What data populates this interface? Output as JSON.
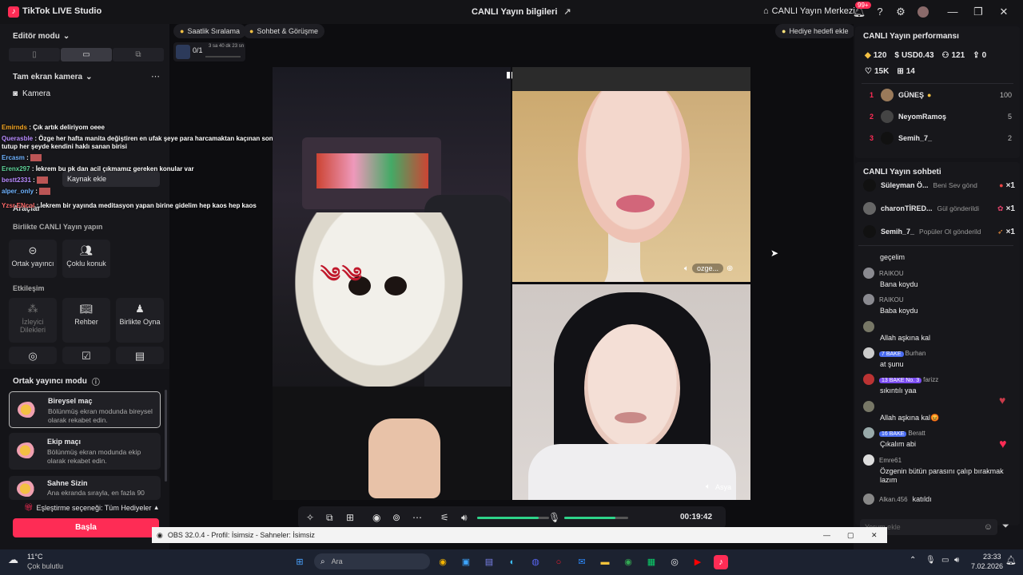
{
  "titlebar": {
    "app_title": "TikTok LIVE Studio",
    "center_title": "CANLI Yayın bilgileri",
    "live_center": "CANLI Yayın Merkezi",
    "notif_count": "99+"
  },
  "left": {
    "editor_mode": "Editör modu",
    "camera_section": "Tam ekran kamera",
    "camera_item": "Kamera",
    "add_source": "Kaynak ekle",
    "tools_label": "Araçlar",
    "cohost_section": "Birlikte CANLI Yayın yapın",
    "cohost_btn": "Ortak yayıncı",
    "multi_guest_btn": "Çoklu konuk",
    "interaction_section": "Etkileşim",
    "viewer_requests": "İzleyici Dilekleri",
    "guide": "Rehber",
    "play_together": "Birlikte Oyna",
    "cohost_mode_title": "Ortak yayıncı modu",
    "modes": [
      {
        "title": "Bireysel maç",
        "desc": "Bölünmüş ekran modunda bireysel olarak rekabet edin."
      },
      {
        "title": "Ekip maçı",
        "desc": "Bölünmüş ekran modunda ekip olarak rekabet edin."
      },
      {
        "title": "Sahne Sizin",
        "desc": "Ana ekranda sırayla, en fazla 90"
      }
    ],
    "match_option": "Eşleştirme seçeneği: Tüm Hediyeler",
    "start_btn": "Başla"
  },
  "overlay_chat": [
    {
      "user": "Emirnds",
      "sep": " : ",
      "msg": "Çık artık deliriyom oeee"
    },
    {
      "user": "Querasble",
      "sep": " : ",
      "msg": "Özge her hafta manita değiştiren en ufak şeye para harcamaktan kaçınan sonra tutup her şeyde kendini haklı sanan birisi"
    },
    {
      "user": "Ercasm",
      "sep": " : ",
      "msg": ""
    },
    {
      "user": "Erenx297",
      "sep": " : ",
      "msg": "İekrem bu pk dan acil çıkmamız gereken konular var"
    },
    {
      "user": "bestt2331",
      "sep": " : ",
      "msg": ""
    },
    {
      "user": "alper_only",
      "sep": " : ",
      "msg": ""
    },
    {
      "user": "Yzsr.ENcol",
      "sep": " : ",
      "msg": "İekrem bir yayında meditasyon yapan birine gidelim hep kaos hep kaos"
    }
  ],
  "center": {
    "pill_hourly": "Saatlik Sıralama",
    "pill_chat": "Sohbet & Görüşme",
    "gift_goal": "Hediye hedefi ekle",
    "goal_progress": "0/1",
    "goal_timer": "3 sa 40 dk 23 sn",
    "cohost_name_1": "ozge...",
    "cohost_name_2": "Asya",
    "timer": "00:19:42",
    "speaker_level": 0.85,
    "mic_level": 0.8
  },
  "right": {
    "perf_title": "CANLI Yayın performansı",
    "stats": {
      "diamonds": "120",
      "usd": "USD0.43",
      "viewers": "121",
      "shares": "0",
      "likes": "15K",
      "gifts": "14"
    },
    "ranking": [
      {
        "rank": "1",
        "name": "GÜNEŞ",
        "value": "100"
      },
      {
        "rank": "2",
        "name": "NeyomRamoş",
        "value": "5"
      },
      {
        "rank": "3",
        "name": "Semih_7_",
        "value": "2"
      }
    ],
    "chat_title": "CANLI Yayın sohbeti",
    "gifts": [
      {
        "name": "Süleyman Ö...",
        "action": "Beni Sev gönd",
        "count": "×1"
      },
      {
        "name": "charonTİRED...",
        "action": "Gül gönderildi",
        "count": "×1"
      },
      {
        "name": "Semih_7_",
        "action": "Popüler Ol gönderild",
        "count": "×1"
      }
    ],
    "chats": [
      {
        "name": "",
        "badges": "",
        "text": "geçelim"
      },
      {
        "name": "RAIKOU",
        "badges": "",
        "text": "Bana koydu"
      },
      {
        "name": "RAIKOU",
        "badges": "",
        "text": "Baba koydu"
      },
      {
        "name": "",
        "badges": "",
        "text": "Allah aşkına kal"
      },
      {
        "name": "Burhan",
        "badges": "7 BAKE",
        "text": "at şunu"
      },
      {
        "name": "farizz",
        "badges": "13 BAKE No. 3",
        "text": "sıkıntılı yaa"
      },
      {
        "name": "",
        "badges": "",
        "text": "Allah aşkına kal😡"
      },
      {
        "name": "Beratt",
        "badges": "16 BAKE",
        "text": "Çıkalım abi"
      },
      {
        "name": "Emre61",
        "badges": "",
        "text": "Özgenin bütün parasını çalıp bırakmak lazım"
      },
      {
        "name": "Alkan.456",
        "badges": "",
        "text": "katıldı"
      }
    ],
    "comment_placeholder": "Yorum ekle"
  },
  "obs": {
    "title": "OBS 32.0.4 - Profil: İsimsiz - Sahneler: İsimsiz"
  },
  "taskbar": {
    "weather_temp": "11°C",
    "weather_desc": "Çok bulutlu",
    "search_placeholder": "Ara",
    "time": "23:33",
    "date": "7.02.2026"
  },
  "colors": {
    "accent": "#fe2c55",
    "green": "#2ed48a"
  }
}
